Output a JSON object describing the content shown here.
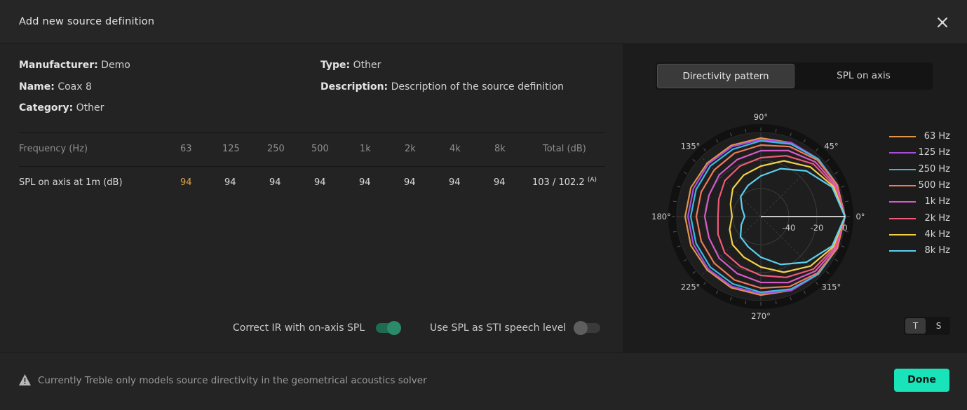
{
  "modal": {
    "title": "Add new source definition"
  },
  "info": {
    "manufacturer_label": "Manufacturer:",
    "manufacturer": "Demo",
    "name_label": "Name:",
    "name": "Coax 8",
    "category_label": "Category:",
    "category": "Other",
    "type_label": "Type:",
    "type": "Other",
    "description_label": "Description:",
    "description": "Description of the source definition"
  },
  "table": {
    "header_label": "Frequency (Hz)",
    "columns": [
      "63",
      "125",
      "250",
      "500",
      "1k",
      "2k",
      "4k",
      "8k"
    ],
    "total_label": "Total (dB)",
    "row_label": "SPL on axis at 1m (dB)",
    "values": [
      "94",
      "94",
      "94",
      "94",
      "94",
      "94",
      "94",
      "94"
    ],
    "total_value": "103 / 102.2",
    "total_suffix": "(A)"
  },
  "toggles": {
    "correct_ir": {
      "label": "Correct IR with on-axis SPL",
      "on": true
    },
    "use_spl": {
      "label": "Use SPL as STI speech level",
      "on": false
    }
  },
  "tabs": {
    "directivity": "Directivity pattern",
    "spl_on_axis": "SPL on axis",
    "active": "directivity"
  },
  "ts_toggle": {
    "t": "T",
    "s": "S",
    "active": "T"
  },
  "footer": {
    "note": "Currently Treble only models source directivity in the geometrical acoustics solver",
    "done_label": "Done"
  },
  "colors": {
    "accent": "#19e3b8",
    "toggle_on": "#1f6a52",
    "knob_on": "#2b8a6a",
    "highlight": "#e0a24a"
  },
  "chart_data": {
    "type": "polar-line",
    "angular_ticks": [
      "0°",
      "45°",
      "90°",
      "135°",
      "180°",
      "225°",
      "270°",
      "315°"
    ],
    "radial_ticks": [
      "-40",
      "-20",
      "0"
    ],
    "rlim": [
      -60,
      0
    ],
    "legend_placement": "right",
    "series": [
      {
        "name": "63 Hz",
        "color": "#e0954a",
        "values": [
          0,
          -1,
          -2,
          -3,
          -4,
          -5,
          -6,
          -6,
          -6
        ]
      },
      {
        "name": "125 Hz",
        "color": "#a84ddd",
        "values": [
          0,
          -1,
          -2,
          -3,
          -5,
          -6,
          -7,
          -8,
          -8
        ]
      },
      {
        "name": "250 Hz",
        "color": "#3bb8e0",
        "values": [
          0,
          -1,
          -2,
          -4,
          -6,
          -8,
          -9,
          -10,
          -10
        ]
      },
      {
        "name": "500 Hz",
        "color": "#f07a5a",
        "values": [
          0,
          -1,
          -3,
          -6,
          -9,
          -11,
          -13,
          -14,
          -14
        ]
      },
      {
        "name": "1k Hz",
        "color": "#d45bc8",
        "values": [
          0,
          -2,
          -5,
          -9,
          -13,
          -16,
          -18,
          -20,
          -20
        ]
      },
      {
        "name": "2k Hz",
        "color": "#ef5a78",
        "values": [
          0,
          -3,
          -7,
          -13,
          -18,
          -22,
          -25,
          -27,
          -28
        ]
      },
      {
        "name": "4k Hz",
        "color": "#f2d04a",
        "values": [
          0,
          -4,
          -10,
          -17,
          -24,
          -29,
          -33,
          -36,
          -38
        ]
      },
      {
        "name": "8k Hz",
        "color": "#5ad0f0",
        "values": [
          0,
          -5,
          -14,
          -23,
          -31,
          -37,
          -41,
          -45,
          -47
        ]
      }
    ],
    "angles_deg": [
      0,
      22.5,
      45,
      67.5,
      90,
      112.5,
      135,
      157.5,
      180
    ]
  }
}
